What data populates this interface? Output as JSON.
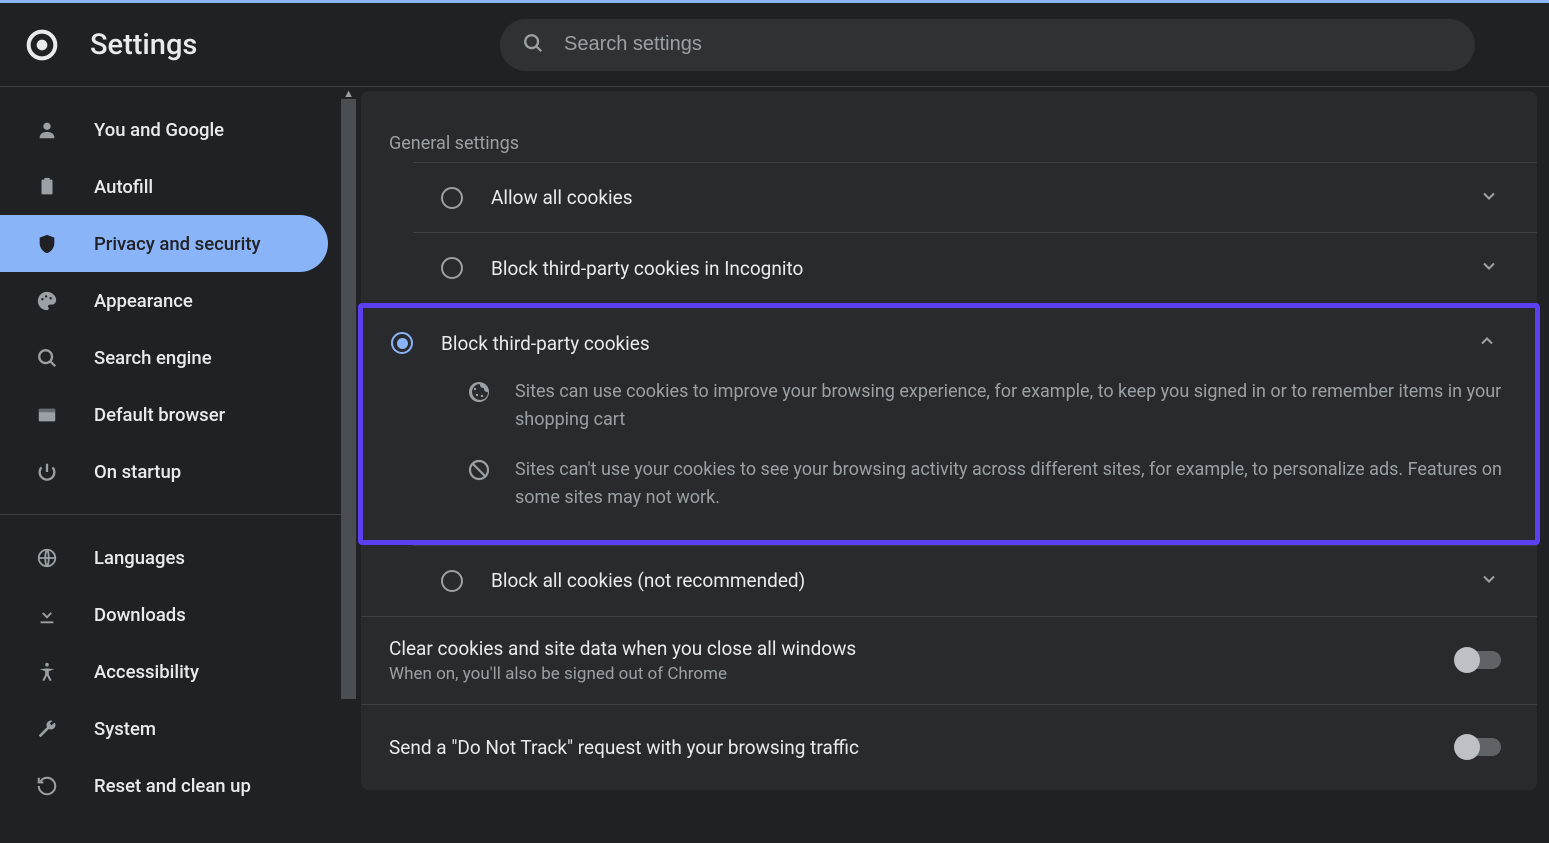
{
  "header": {
    "title": "Settings",
    "search_placeholder": "Search settings"
  },
  "sidebar": {
    "items": [
      {
        "icon": "person",
        "label": "You and Google"
      },
      {
        "icon": "clipboard",
        "label": "Autofill"
      },
      {
        "icon": "shield",
        "label": "Privacy and security",
        "selected": true
      },
      {
        "icon": "palette",
        "label": "Appearance"
      },
      {
        "icon": "search",
        "label": "Search engine"
      },
      {
        "icon": "browser",
        "label": "Default browser"
      },
      {
        "icon": "power",
        "label": "On startup"
      }
    ],
    "items2": [
      {
        "icon": "globe",
        "label": "Languages"
      },
      {
        "icon": "download",
        "label": "Downloads"
      },
      {
        "icon": "accessibility",
        "label": "Accessibility"
      },
      {
        "icon": "wrench",
        "label": "System"
      },
      {
        "icon": "restore",
        "label": "Reset and clean up"
      }
    ]
  },
  "main": {
    "section_label": "General settings",
    "options": [
      {
        "label": "Allow all cookies",
        "expand": "down"
      },
      {
        "label": "Block third-party cookies in Incognito",
        "expand": "down"
      },
      {
        "label": "Block third-party cookies",
        "expand": "up",
        "checked": true,
        "details": [
          {
            "icon": "cookie",
            "text": "Sites can use cookies to improve your browsing experience, for example, to keep you signed in or to remember items in your shopping cart"
          },
          {
            "icon": "block",
            "text": "Sites can't use your cookies to see your browsing activity across different sites, for example, to personalize ads. Features on some sites may not work."
          }
        ]
      },
      {
        "label": "Block all cookies (not recommended)",
        "expand": "down"
      }
    ],
    "settings": [
      {
        "title": "Clear cookies and site data when you close all windows",
        "sub": "When on, you'll also be signed out of Chrome"
      },
      {
        "title": "Send a \"Do Not Track\" request with your browsing traffic"
      }
    ]
  }
}
